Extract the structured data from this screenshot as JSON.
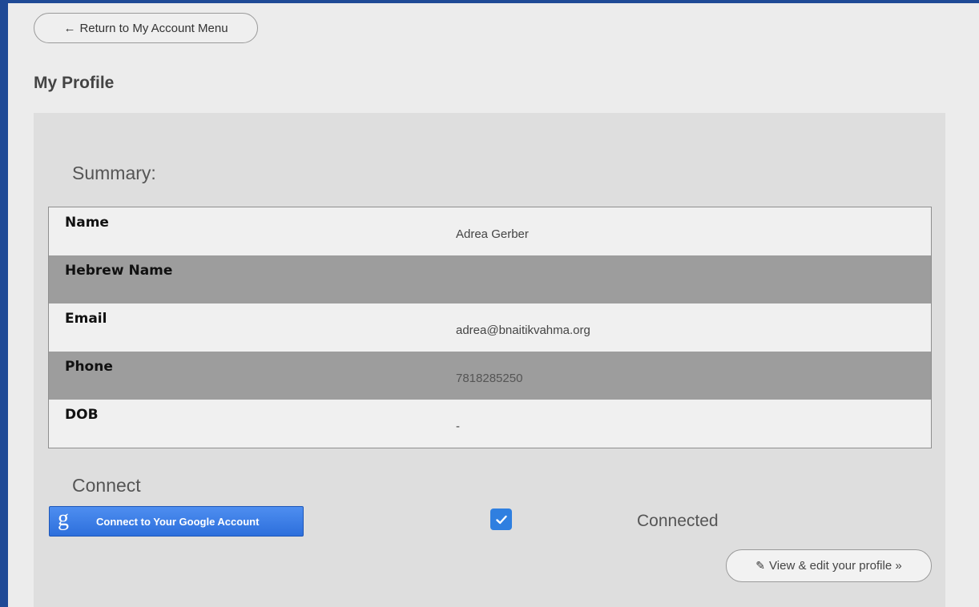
{
  "nav": {
    "back_label": "Return to My Account Menu",
    "back_icon": "left-arrow-icon"
  },
  "page": {
    "title": "My Profile"
  },
  "summary": {
    "title": "Summary:",
    "rows": [
      {
        "label": "Name",
        "value": "Adrea Gerber"
      },
      {
        "label": "Hebrew Name",
        "value": ""
      },
      {
        "label": "Email",
        "value": "adrea@bnaitikvahma.org"
      },
      {
        "label": "Phone",
        "value": "7818285250"
      },
      {
        "label": "DOB",
        "value": "-"
      }
    ]
  },
  "connect": {
    "title": "Connect",
    "google_button_label": "Connect to Your Google Account",
    "google_icon": "google-g-icon",
    "connected_checked": true,
    "connected_label": "Connected"
  },
  "actions": {
    "edit_label": "View & edit your profile »",
    "edit_icon": "pencil-icon"
  },
  "colors": {
    "page_border": "#1f4a96",
    "google_blue": "#2d6fdc",
    "checkbox_blue": "#2f7fe0",
    "alt_row": "#9d9d9d"
  }
}
